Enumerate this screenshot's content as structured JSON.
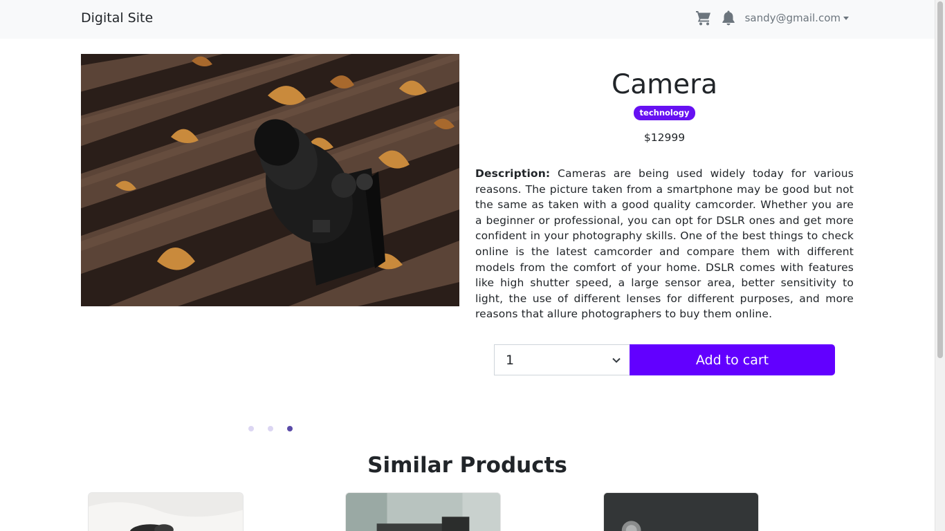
{
  "navbar": {
    "brand": "Digital Site",
    "cart_icon": "cart-icon",
    "bell_icon": "bell-icon",
    "user_email": "sandy@gmail.com"
  },
  "product": {
    "title": "Camera",
    "category_badge": "technology",
    "price": "$12999",
    "description_label": "Description:",
    "description": "Cameras are being used widely today for various reasons. The picture taken from a smartphone may be good but not the same as taken with a good quality camcorder. Whether you are a beginner or professional, you can opt for DSLR ones and get more confident in your photography skills. One of the best things to check online is the latest camcorder and compare them with different models from the comfort of your home. DSLR comes with features like high shutter speed, a large sensor area, better sensitivity to light, the use of different lenses for different purposes, and more reasons that allure photographers to buy them online.",
    "quantity_selected": "1",
    "add_to_cart_label": "Add to cart"
  },
  "carousel": {
    "slide_count": 3,
    "active_index": 2
  },
  "similar": {
    "heading": "Similar Products"
  },
  "colors": {
    "accent": "#6200ff",
    "badge": "#6610f2",
    "navbar_bg": "#f8f9fa"
  }
}
